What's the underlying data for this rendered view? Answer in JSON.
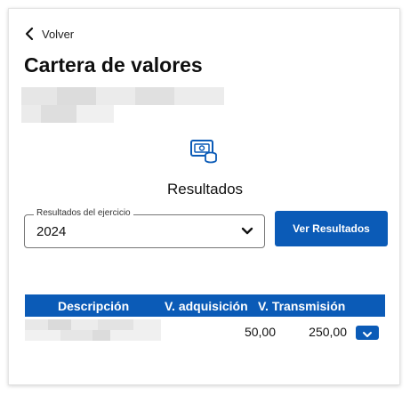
{
  "nav": {
    "back_label": "Volver"
  },
  "page": {
    "title": "Cartera de valores"
  },
  "section": {
    "title": "Resultados"
  },
  "filter": {
    "legend": "Resultados del ejercicio",
    "selected_value": "2024"
  },
  "actions": {
    "results_button_label": "Ver Resultados"
  },
  "table": {
    "headers": [
      "Descripción",
      "V. adquisición",
      "V. Transmisión"
    ],
    "rows": [
      {
        "adquisicion": "50,00",
        "transmision": "250,00"
      }
    ]
  },
  "colors": {
    "accent": "#0b5bb7",
    "text": "#111111"
  },
  "icons": {
    "back": "chevron-left-icon",
    "section": "money-coins-icon",
    "select": "chevron-down-icon",
    "row_expand": "chevron-down-icon"
  }
}
